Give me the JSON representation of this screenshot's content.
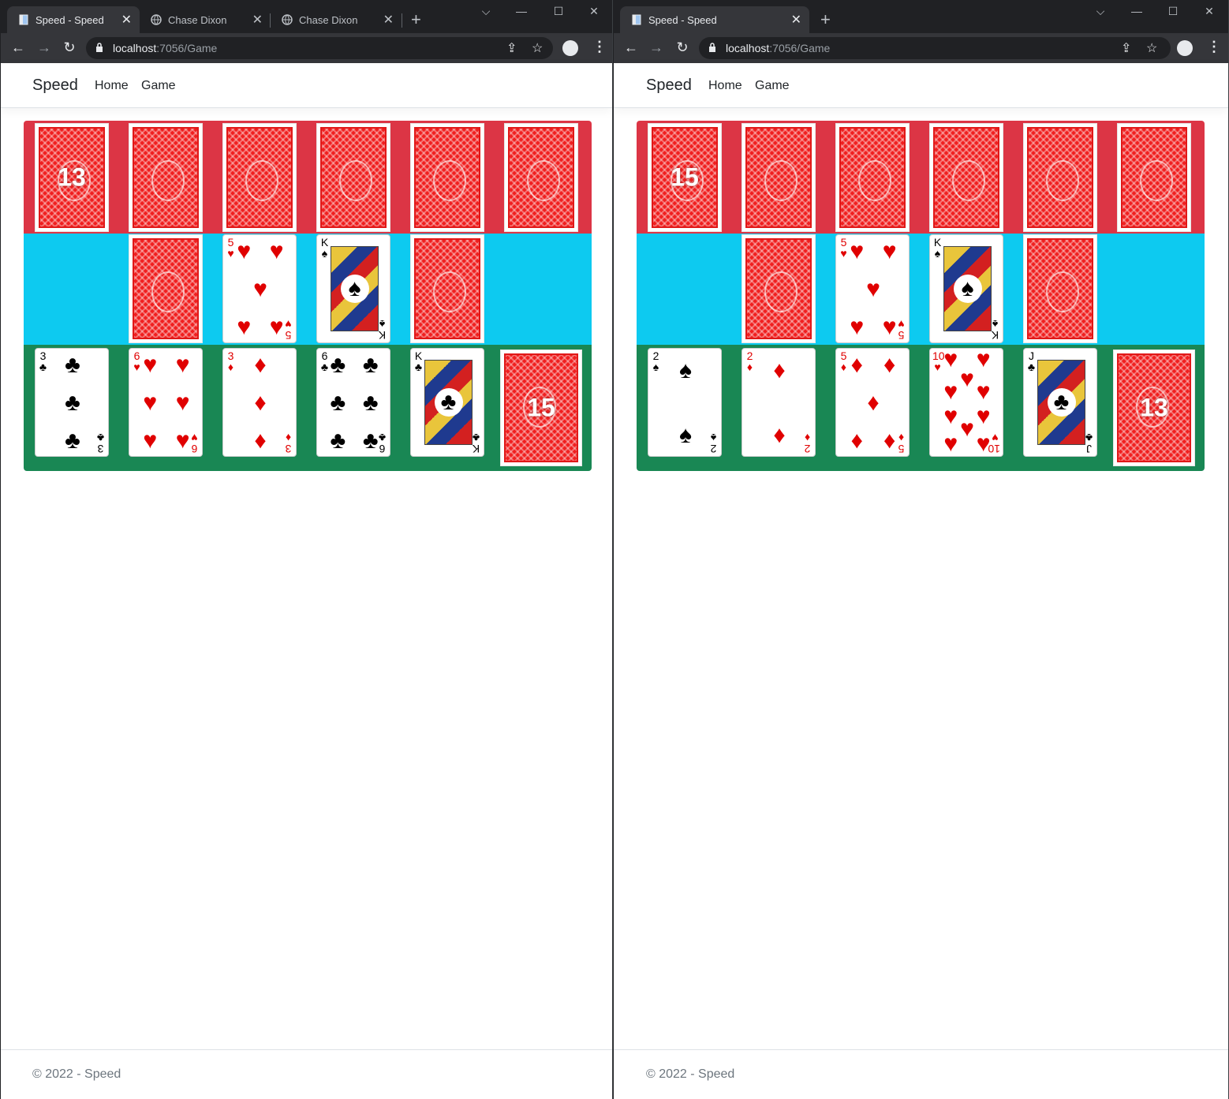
{
  "windows": [
    {
      "tabs": [
        {
          "title": "Speed - Speed",
          "active": true
        },
        {
          "title": "Chase Dixon",
          "active": false
        },
        {
          "title": "Chase Dixon",
          "active": false
        }
      ],
      "url_host": "localhost",
      "url_rest": ":7056/Game",
      "brand": "Speed",
      "nav": [
        "Home",
        "Game"
      ],
      "opponent": {
        "pile_count": "13",
        "hand_backs": 6
      },
      "middle": [
        {
          "type": "empty"
        },
        {
          "type": "back"
        },
        {
          "type": "face",
          "rank": "5",
          "suit": "♥",
          "color": "red"
        },
        {
          "type": "face",
          "rank": "K",
          "suit": "♠",
          "color": "blk",
          "court": true
        },
        {
          "type": "back"
        },
        {
          "type": "empty"
        }
      ],
      "player": [
        {
          "rank": "3",
          "suit": "♣",
          "color": "blk"
        },
        {
          "rank": "6",
          "suit": "♥",
          "color": "red"
        },
        {
          "rank": "3",
          "suit": "♦",
          "color": "red"
        },
        {
          "rank": "6",
          "suit": "♣",
          "color": "blk"
        },
        {
          "rank": "K",
          "suit": "♣",
          "color": "blk",
          "court": true
        }
      ],
      "player_pile_count": "15",
      "footer": "© 2022 - Speed"
    },
    {
      "tabs": [
        {
          "title": "Speed - Speed",
          "active": true
        }
      ],
      "url_host": "localhost",
      "url_rest": ":7056/Game",
      "brand": "Speed",
      "nav": [
        "Home",
        "Game"
      ],
      "opponent": {
        "pile_count": "15",
        "hand_backs": 6
      },
      "middle": [
        {
          "type": "empty"
        },
        {
          "type": "back"
        },
        {
          "type": "face",
          "rank": "5",
          "suit": "♥",
          "color": "red"
        },
        {
          "type": "face",
          "rank": "K",
          "suit": "♠",
          "color": "blk",
          "court": true
        },
        {
          "type": "back"
        },
        {
          "type": "empty"
        }
      ],
      "player": [
        {
          "rank": "2",
          "suit": "♠",
          "color": "blk"
        },
        {
          "rank": "2",
          "suit": "♦",
          "color": "red"
        },
        {
          "rank": "5",
          "suit": "♦",
          "color": "red"
        },
        {
          "rank": "10",
          "suit": "♥",
          "color": "red"
        },
        {
          "rank": "J",
          "suit": "♣",
          "color": "blk",
          "court": true
        }
      ],
      "player_pile_count": "13",
      "footer": "© 2022 - Speed"
    }
  ]
}
